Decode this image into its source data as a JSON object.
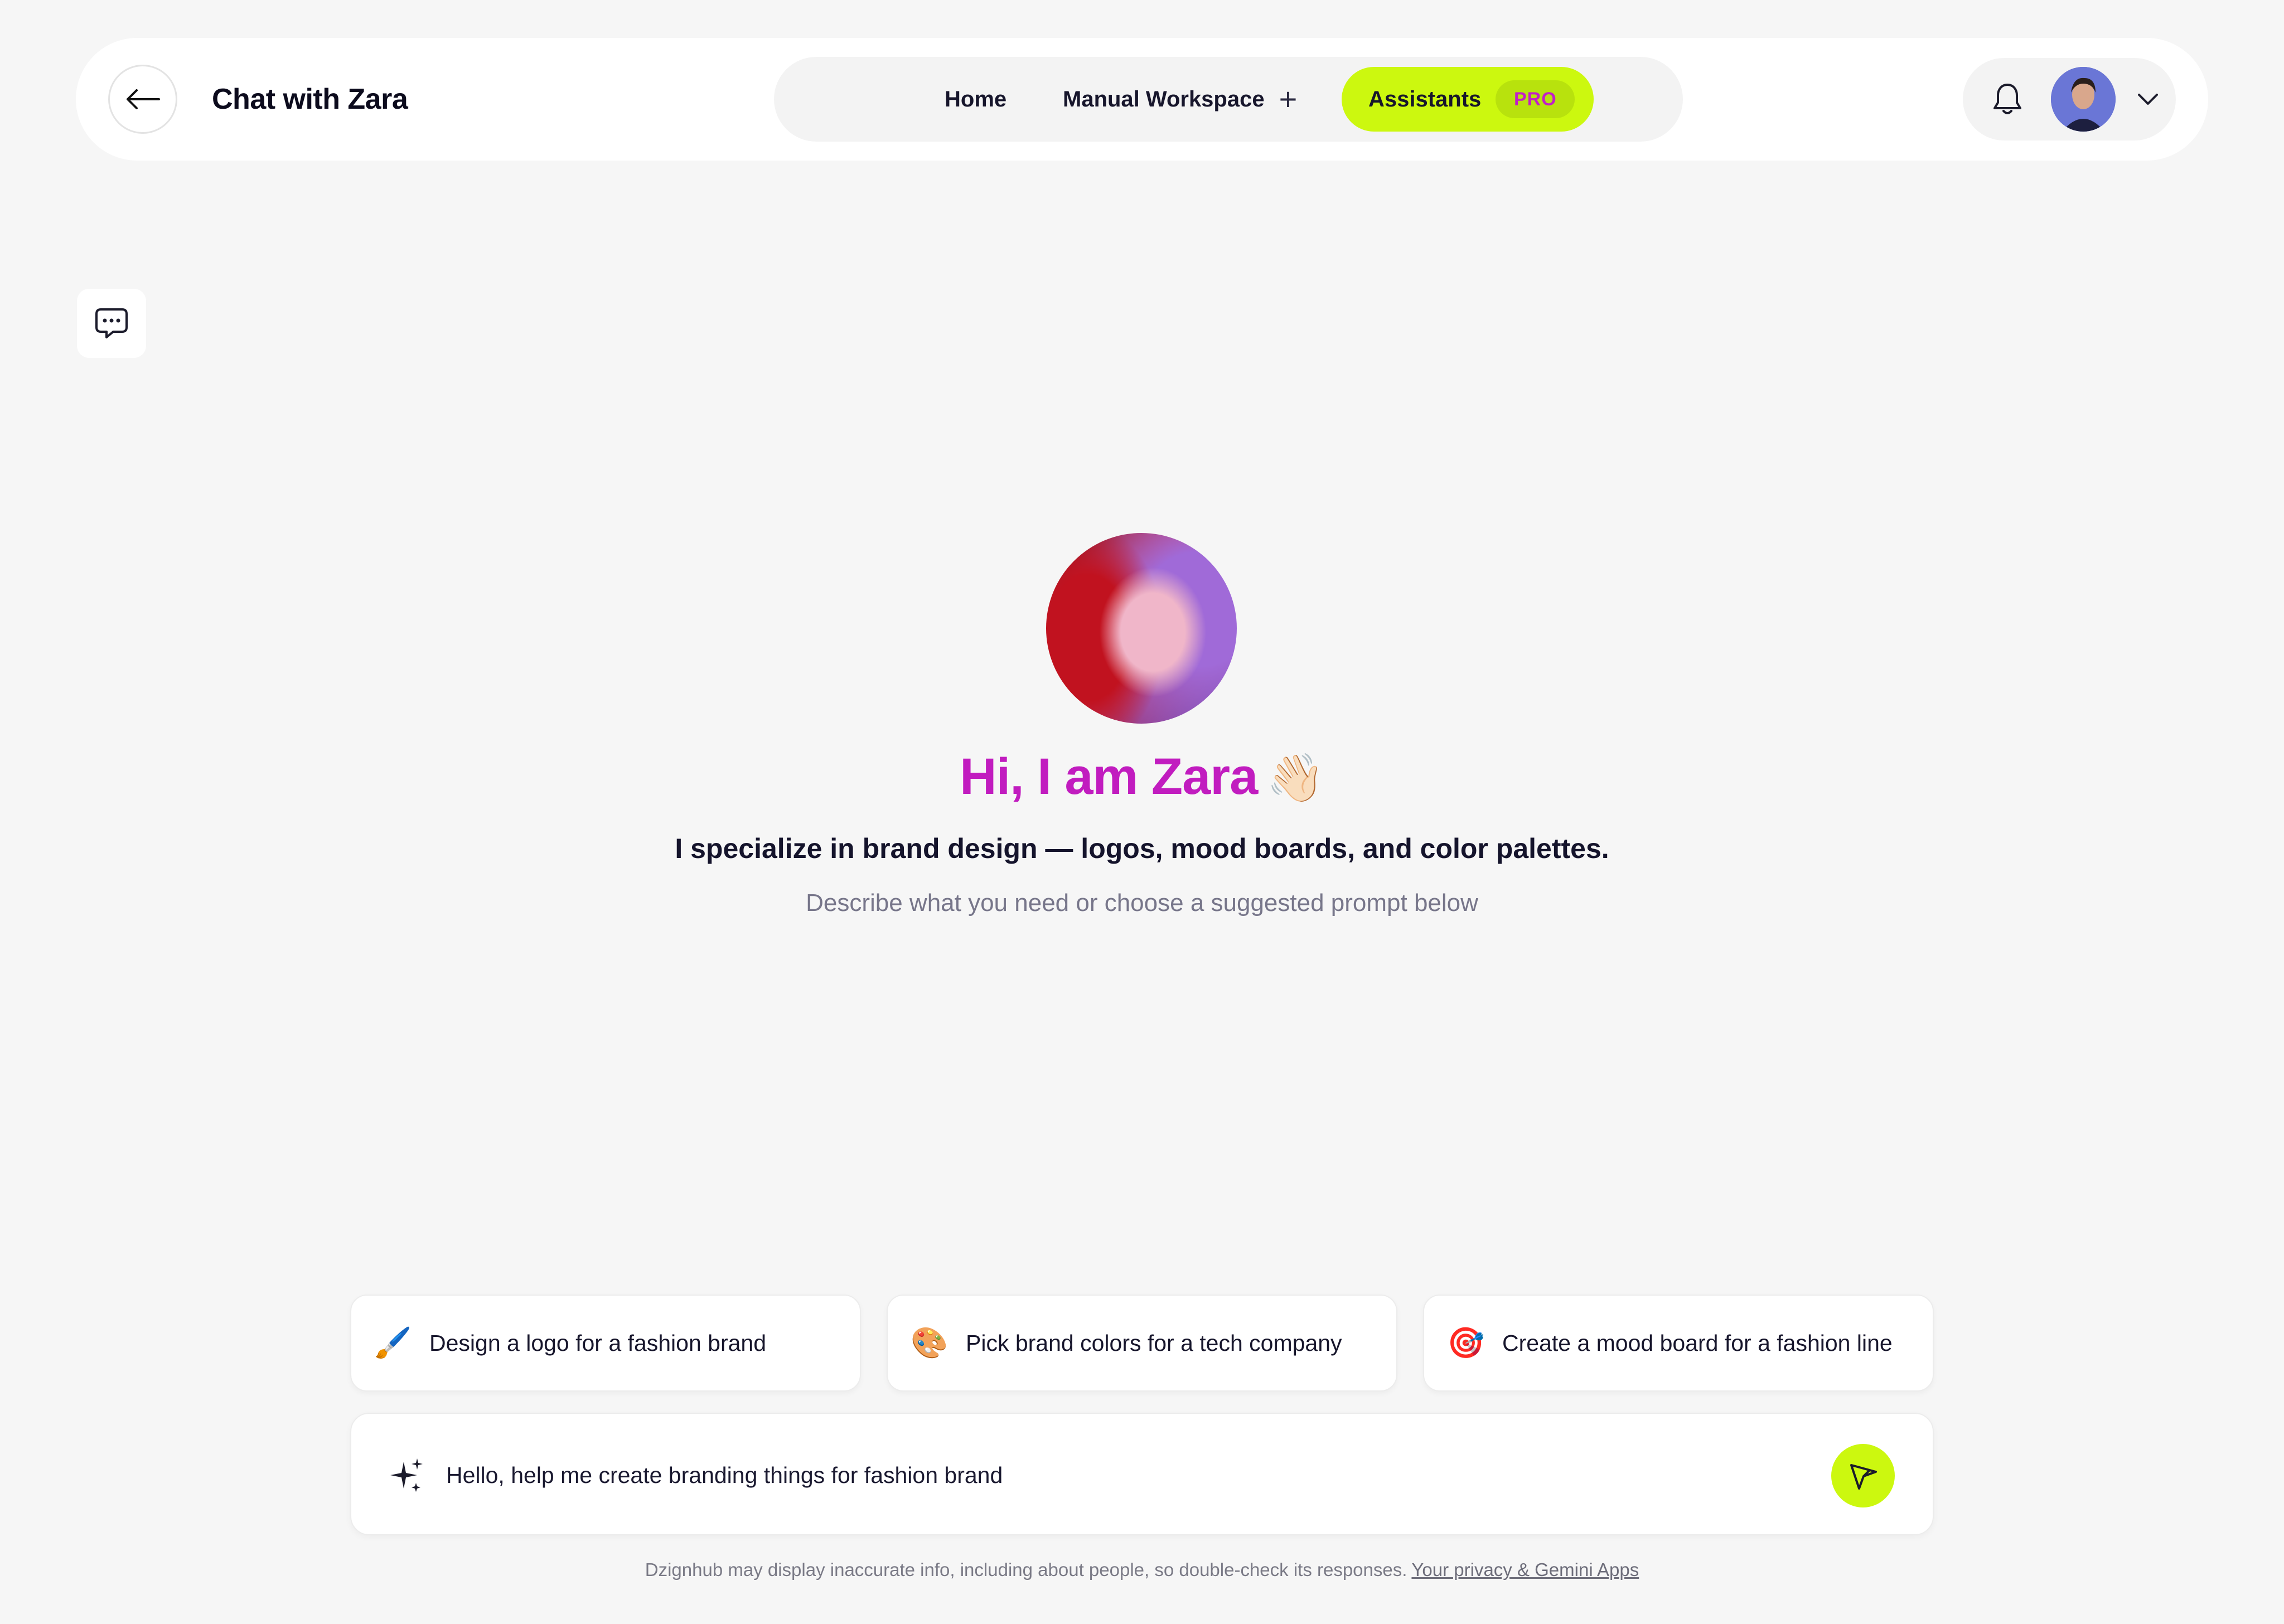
{
  "header": {
    "back_icon": "arrow-left-icon",
    "title": "Chat with Zara"
  },
  "nav": {
    "home": "Home",
    "manual_workspace": "Manual Workspace",
    "manual_add_icon": "plus-icon",
    "assistants": "Assistants",
    "assistants_badge": "PRO"
  },
  "user": {
    "notification_icon": "bell-icon",
    "avatar_icon": "user-avatar",
    "menu_icon": "chevron-down-icon"
  },
  "sidebar": {
    "chat_icon": "chat-bubble-icon"
  },
  "hero": {
    "title": "Hi, I am Zara",
    "emoji": "👋🏻",
    "subtitle": "I specialize in brand design — logos, mood boards, and color palettes.",
    "hint": "Describe what you need or choose a suggested prompt below"
  },
  "suggestions": [
    {
      "emoji": "🖌️",
      "icon": "paintbrush-icon",
      "label": "Design a logo for a fashion brand"
    },
    {
      "emoji": "🎨",
      "icon": "palette-icon",
      "label": "Pick brand colors for a tech company"
    },
    {
      "emoji": "🎯",
      "icon": "target-icon",
      "label": "Create a mood board for a fashion line"
    }
  ],
  "composer": {
    "value": "Hello, help me create branding things for fashion brand",
    "sparkle_icon": "sparkle-icon",
    "send_icon": "send-icon"
  },
  "footer": {
    "disclaimer": "Dzignhub may display inaccurate info, including about people, so double-check its responses.",
    "link": "Your privacy & Gemini Apps"
  },
  "colors": {
    "accent": "#ccf80f",
    "brand_magenta": "#c11cbf",
    "background": "#f6f6f6"
  }
}
